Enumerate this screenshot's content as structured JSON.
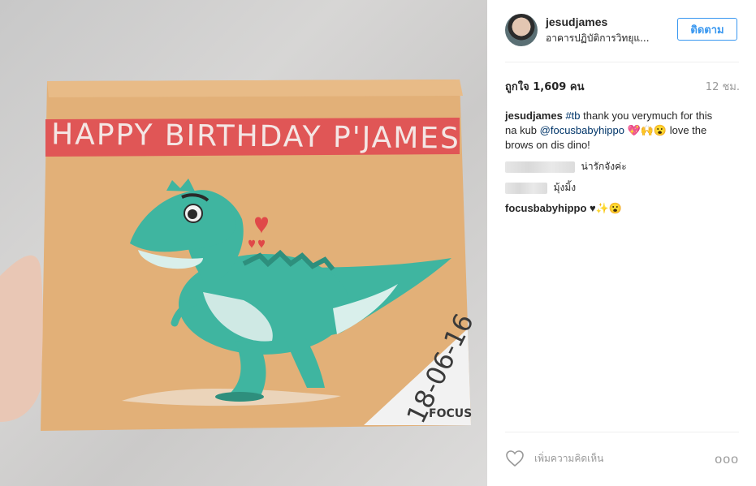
{
  "photo": {
    "banner_text": "HAPPY BIRTHDAY P'JAMES",
    "date_text": "18-06-16",
    "signature": "FOCUS"
  },
  "post": {
    "username": "jesudjames",
    "location": "อาคารปฏิบัติการวิทยุแ...",
    "follow_label": "ติดตาม",
    "likes": "ถูกใจ 1,609 คน",
    "time": "12 ชม.",
    "comments": [
      {
        "user": "jesudjames",
        "hashtag": "#tb",
        "text_a": " thank you verymuch for this na kub ",
        "mention": "@focusbabyhippo",
        "emoji": " 💖🙌😮",
        "text_b": " love the brows on dis dino!"
      },
      {
        "user_hidden": true,
        "text": "น่ารักจังค่ะ"
      },
      {
        "user_hidden": true,
        "text": "มุ้งมิ้ง"
      },
      {
        "user": "focusbabyhippo",
        "text": " ♥✨😮"
      }
    ],
    "add_comment_placeholder": "เพิ่มความคิดเห็น",
    "more_label": "ooo"
  },
  "colors": {
    "canvas": "#e2b078",
    "banner": "#e05656",
    "dino": "#3fb5a0",
    "follow_blue": "#3897f0",
    "link": "#003569"
  },
  "icons": [
    "heart-icon",
    "more-options-icon"
  ]
}
